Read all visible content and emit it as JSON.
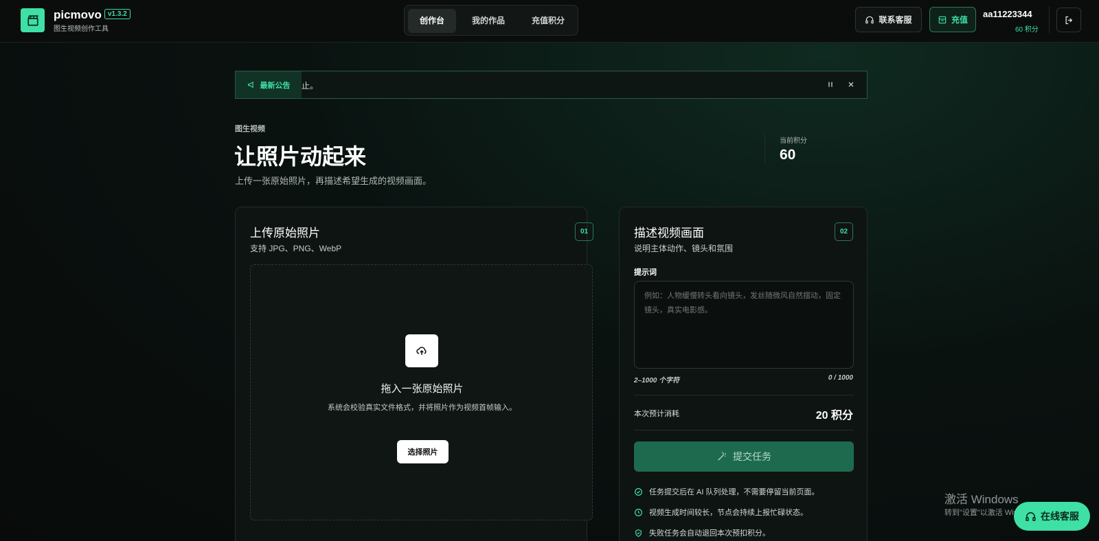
{
  "brand": {
    "name": "picmovo",
    "version": "v1.3.2",
    "tagline": "图生视频创作工具"
  },
  "nav": {
    "tabs": [
      {
        "label": "创作台"
      },
      {
        "label": "我的作品"
      },
      {
        "label": "充值积分"
      }
    ],
    "active_index": 0
  },
  "header": {
    "support_label": "联系客服",
    "recharge_label": "充值"
  },
  "user": {
    "name": "aa11223344",
    "points": "60 积分"
  },
  "announcement": {
    "tag": "最新公告",
    "text": "止。"
  },
  "hero": {
    "eyebrow": "图生视频",
    "title": "让照片动起来",
    "subtitle": "上传一张原始照片，再描述希望生成的视频画面。",
    "points_label": "当前积分",
    "points_value": "60"
  },
  "upload_card": {
    "title": "上传原始照片",
    "step": "01",
    "subtitle": "支持 JPG、PNG、WebP",
    "drop_title": "拖入一张原始照片",
    "drop_desc": "系统会校验真实文件格式，并将照片作为视频首帧输入。",
    "choose_label": "选择照片"
  },
  "prompt_card": {
    "title": "描述视频画面",
    "step": "02",
    "subtitle": "说明主体动作、镜头和氛围",
    "field_label": "提示词",
    "placeholder": "例如：人物缓慢转头看向镜头，发丝随微风自然摆动，固定镜头，真实电影感。",
    "char_hint": "2–1000 个字符",
    "char_count": "0 / 1000",
    "cost_label": "本次预计消耗",
    "cost_value": "20 积分",
    "submit_label": "提交任务",
    "notes": [
      {
        "text": "任务提交后在 AI 队列处理，不需要停留当前页面。",
        "icon": "check-circle-icon"
      },
      {
        "text": "视频生成时间较长，节点会持续上报忙碌状态。",
        "icon": "clock-icon"
      },
      {
        "text": "失败任务会自动退回本次预扣积分。",
        "icon": "shield-check-icon"
      }
    ]
  },
  "overlay": {
    "windows_title": "激活 Windows",
    "windows_sub": "转到\"设置\"以激活 Windows。",
    "chat_label": "在线客服"
  },
  "colors": {
    "accent": "#3ee0a6",
    "submit": "#1d6a4f",
    "background": "#0a0d0c"
  }
}
